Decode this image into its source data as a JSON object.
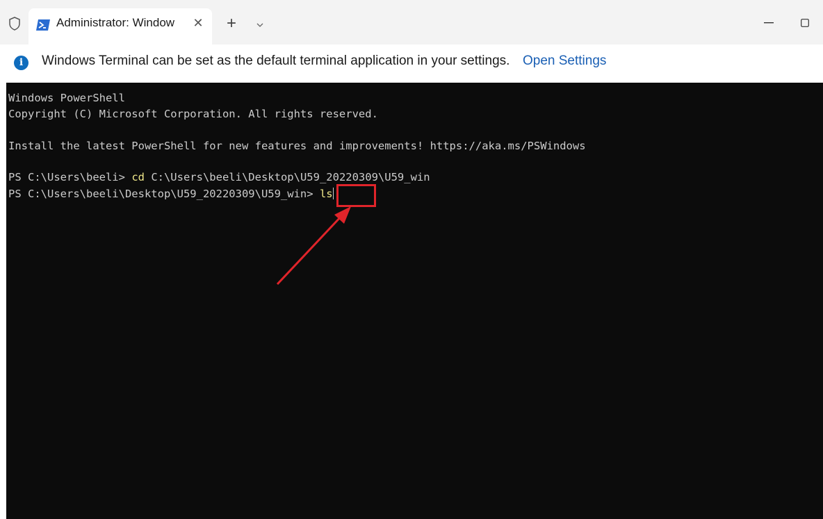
{
  "titlebar": {
    "tab_title": "Administrator: Window",
    "tab_close": "✕",
    "new_tab": "+",
    "minimize": "—",
    "maximize": "☐"
  },
  "infobar": {
    "icon_glyph": "i",
    "message": "Windows Terminal can be set as the default terminal application in your settings.",
    "link": "Open Settings"
  },
  "terminal": {
    "line1": "Windows PowerShell",
    "line2": "Copyright (C) Microsoft Corporation. All rights reserved.",
    "line3": "Install the latest PowerShell for new features and improvements! https://aka.ms/PSWindows",
    "prompt1": "PS C:\\Users\\beeli> ",
    "cmd1_keyword": "cd",
    "cmd1_args": " C:\\Users\\beeli\\Desktop\\U59_20220309\\U59_win",
    "prompt2": "PS C:\\Users\\beeli\\Desktop\\U59_20220309\\U59_win> ",
    "cmd2": "ls"
  },
  "colors": {
    "terminal_bg": "#0c0c0c",
    "terminal_text": "#cccccc",
    "command_keyword": "#f0e88a",
    "link": "#1a5fb4",
    "annotation": "#e0242a"
  }
}
